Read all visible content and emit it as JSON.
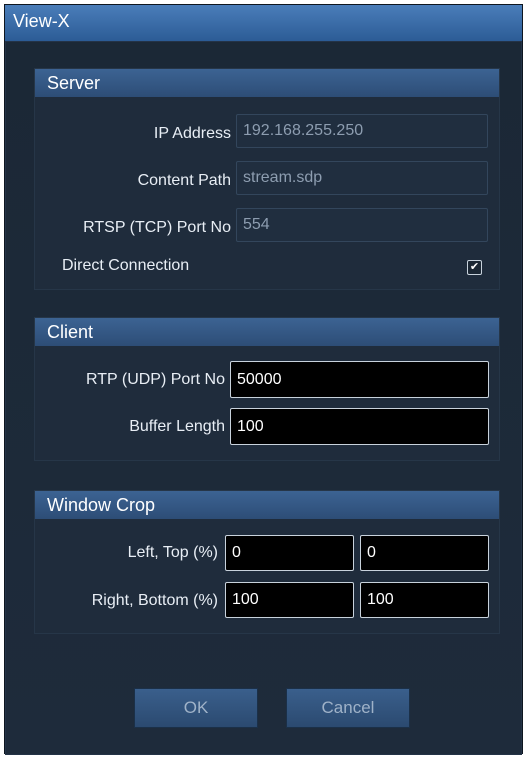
{
  "window": {
    "title": "View-X"
  },
  "server": {
    "title": "Server",
    "ip_label": "IP Address",
    "ip_value": "192.168.255.250",
    "content_path_label": "Content Path",
    "content_path_value": "stream.sdp",
    "rtsp_port_label": "RTSP (TCP) Port No",
    "rtsp_port_value": "554",
    "direct_label": "Direct Connection",
    "direct_checked": true
  },
  "client": {
    "title": "Client",
    "rtp_port_label": "RTP (UDP) Port No",
    "rtp_port_value": "50000",
    "buffer_label": "Buffer Length",
    "buffer_value": "100"
  },
  "window_crop": {
    "title": "Window Crop",
    "left_top_label": "Left, Top (%)",
    "left_value": "0",
    "top_value": "0",
    "right_bottom_label": "Right, Bottom (%)",
    "right_value": "100",
    "bottom_value": "100"
  },
  "buttons": {
    "ok": "OK",
    "cancel": "Cancel"
  },
  "colors": {
    "title_bar": "#3b6ea8",
    "background": "#1d2a3a",
    "group_header": "#35587f"
  }
}
